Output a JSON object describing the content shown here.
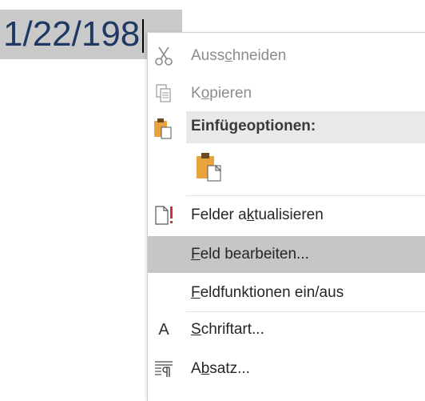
{
  "document": {
    "field_value": "1/22/198"
  },
  "context_menu": {
    "cut": {
      "pre": "Auss",
      "key": "c",
      "post": "hneiden"
    },
    "copy": {
      "pre": "K",
      "key": "o",
      "post": "pieren"
    },
    "paste_options_header": "Einfügeoptionen:",
    "update_fields": {
      "pre": "Felder a",
      "key": "k",
      "post": "tualisieren"
    },
    "edit_field": {
      "pre": "",
      "key": "F",
      "post": "eld bearbeiten..."
    },
    "toggle_field_codes": {
      "pre": "",
      "key": "F",
      "post": "eldfunktionen ein/aus"
    },
    "font": {
      "pre": "",
      "key": "S",
      "post": "chriftart..."
    },
    "paragraph": {
      "pre": "A",
      "key": "b",
      "post": "satz..."
    },
    "font_icon_glyph": "A"
  },
  "colors": {
    "field_text": "#1f3864",
    "field_highlight": "#c9c9c9",
    "menu_hover": "#c6c6c6",
    "disabled_text": "#8c8c8c",
    "clipboard_orange": "#e8a33c"
  },
  "icons": {
    "cut": "scissors-icon",
    "copy": "copy-icon",
    "paste_options": "clipboard-icon",
    "paste_keep_formatting": "paste-option-icon",
    "update_fields": "update-field-icon",
    "font": "font-icon",
    "paragraph": "paragraph-icon"
  }
}
